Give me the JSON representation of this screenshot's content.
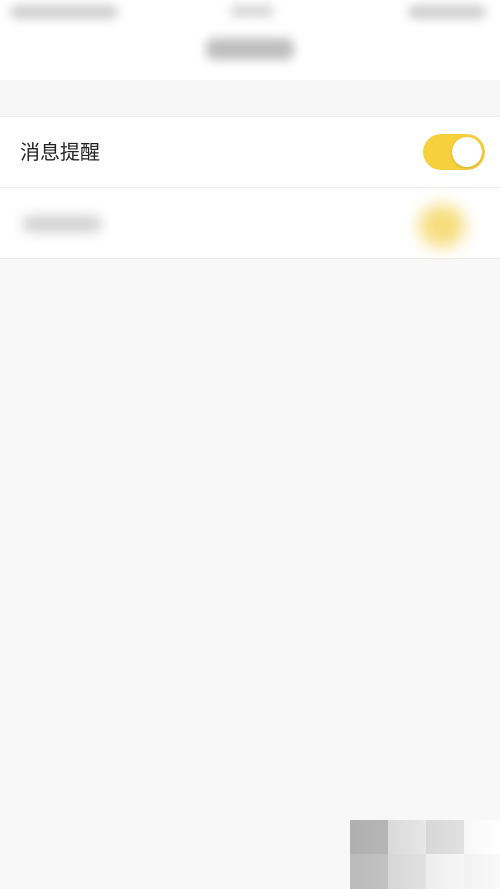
{
  "settings": {
    "rows": [
      {
        "label": "消息提醒",
        "enabled": true
      },
      {
        "enabled": true
      }
    ]
  },
  "colors": {
    "toggle_on": "#f7d13d",
    "background": "#f8f8f8",
    "row_background": "#ffffff"
  }
}
